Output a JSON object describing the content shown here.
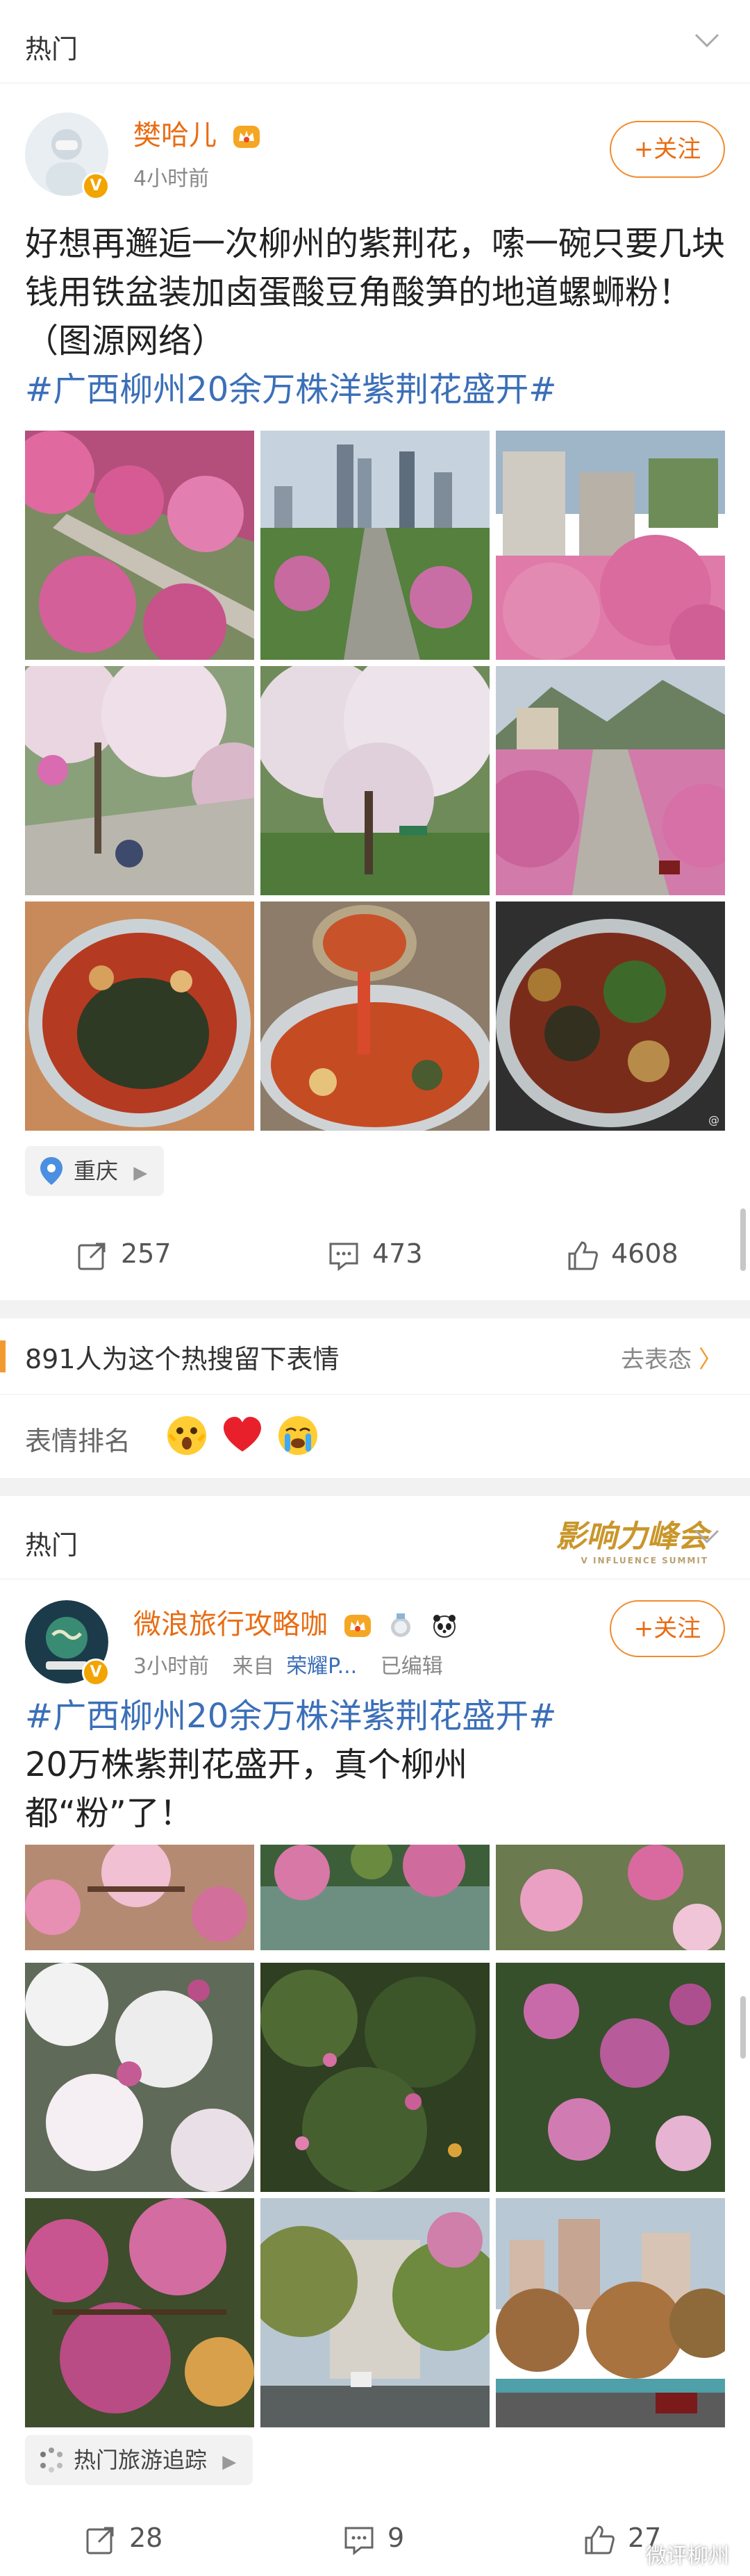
{
  "post1": {
    "section_label": "热门",
    "username": "樊哈儿",
    "time": "4小时前",
    "follow_label": "+关注",
    "text_body": "好想再邂逅一次柳州的紫荆花，嗦一碗只要几块钱用铁盆装加卤蛋酸豆角酸笋的地道螺蛳粉！（图源网络）",
    "hashtag": "#广西柳州20余万株洋紫荆花盛开#",
    "location": "重庆",
    "reposts": "257",
    "comments": "473",
    "likes": "4608",
    "image_icons": [
      "flower-avenue-photo",
      "city-skyline-photo",
      "pink-trees-street-photo",
      "flower-branch-photo",
      "flowering-tree-park-photo",
      "valley-road-photo",
      "noodle-bowl-photo",
      "soup-ladle-photo",
      "pickled-noodle-photo"
    ]
  },
  "hot_search": {
    "text": "891人为这个热搜留下表情",
    "action": "去表态",
    "ranking_label": "表情排名",
    "emojis": [
      "shocked-emoji",
      "heart-emoji",
      "crying-emoji"
    ]
  },
  "post2": {
    "section_label": "热门",
    "summit_title": "影响力峰会",
    "summit_sub": "V INFLUENCE SUMMIT",
    "username": "微浪旅行攻略咖",
    "time": "3小时前",
    "source_prefix": "来自",
    "source": "荣耀P...",
    "edited": "已编辑",
    "follow_label": "+关注",
    "hashtag": "#广西柳州20余万株洋紫荆花盛开#",
    "line1": "20万株紫荆花盛开，真个柳州",
    "line2": "都“粉”了！",
    "topic_chip": "热门旅游追踪",
    "reposts": "28",
    "comments": "9",
    "likes": "27",
    "watermark": "微评柳州",
    "image_icons": [
      "blossom-closeup-photo",
      "pond-trees-photo",
      "pink-flower-photo",
      "white-blossoms-photo",
      "tree-canopy-photo",
      "purple-flowers-photo",
      "pink-branches-photo",
      "street-trees-photo",
      "riverside-buildings-photo"
    ]
  },
  "colors": {
    "accent_orange": "#e86d14",
    "hashtag_blue": "#3b6fb8",
    "divider_gray": "#f2f2f2"
  }
}
